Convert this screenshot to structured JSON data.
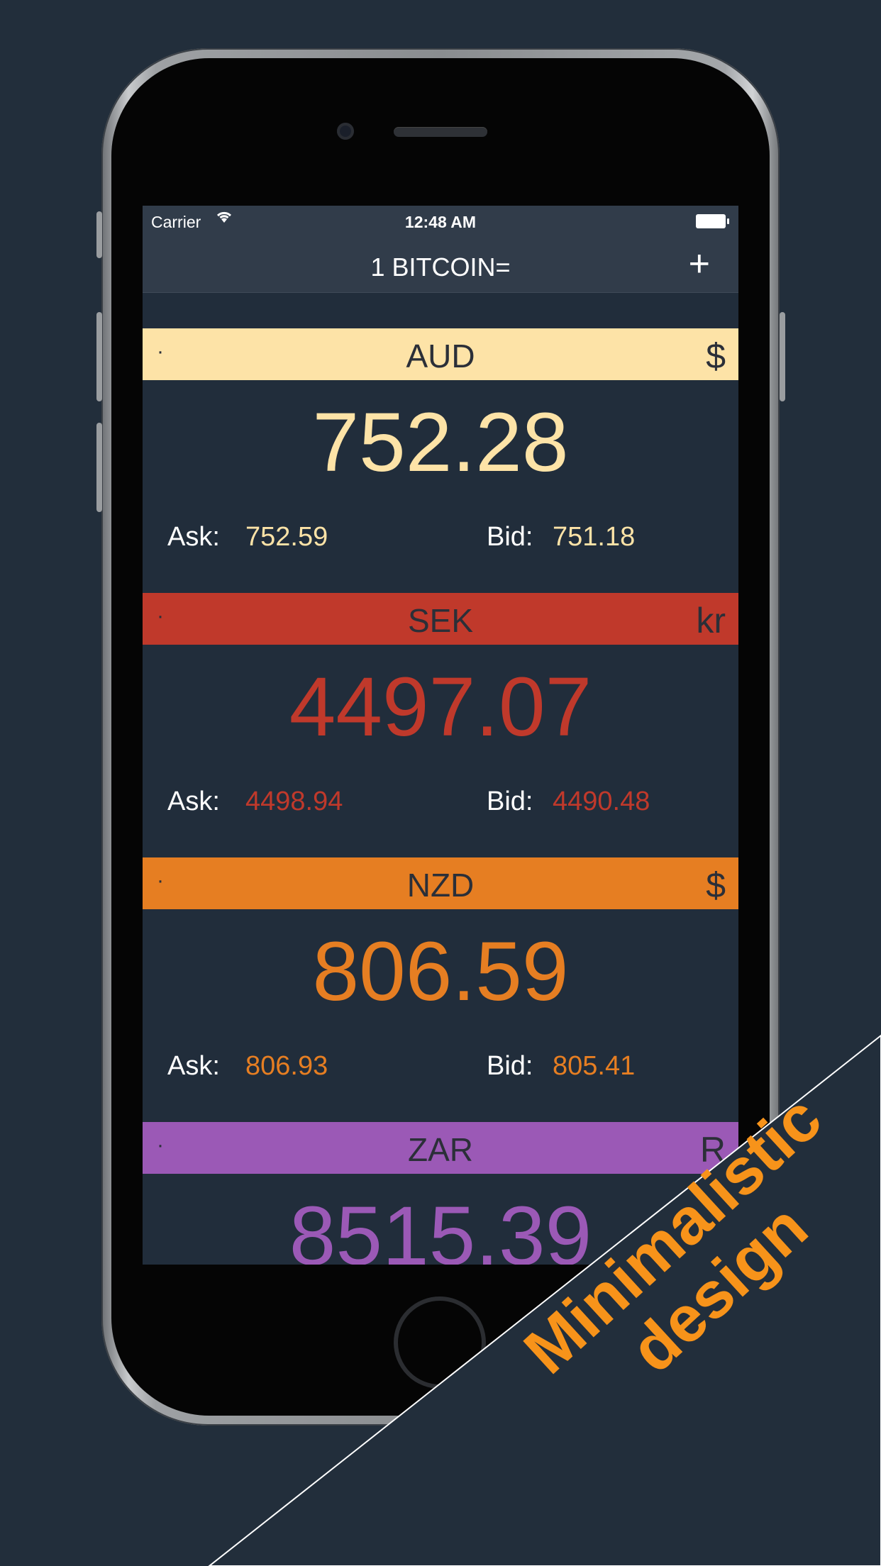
{
  "colors": {
    "background": "#222e3b",
    "screen_bg": "#212d3b",
    "banner_text": "#f7931a"
  },
  "status_bar": {
    "carrier": "Carrier",
    "wifi_icon": "wifi-icon",
    "time": "12:48 AM",
    "battery_icon": "battery-icon"
  },
  "nav": {
    "title": "1 BITCOIN=",
    "add_label": "+"
  },
  "currencies": [
    {
      "code": "AUD",
      "symbol": "$",
      "dot": "·",
      "price": "752.28",
      "ask_label": "Ask:",
      "ask": "752.59",
      "bid_label": "Bid:",
      "bid": "751.18",
      "bar_color": "#fde3a7",
      "value_color": "#fde3a7"
    },
    {
      "code": "SEK",
      "symbol": "kr",
      "dot": "·",
      "price": "4497.07",
      "ask_label": "Ask:",
      "ask": "4498.94",
      "bid_label": "Bid:",
      "bid": "4490.48",
      "bar_color": "#c0392b",
      "value_color": "#c0392b"
    },
    {
      "code": "NZD",
      "symbol": "$",
      "dot": "·",
      "price": "806.59",
      "ask_label": "Ask:",
      "ask": "806.93",
      "bid_label": "Bid:",
      "bid": "805.41",
      "bar_color": "#e67e22",
      "value_color": "#e67e22"
    },
    {
      "code": "ZAR",
      "symbol": "R",
      "dot": "·",
      "price": "8515.39",
      "ask_label": "",
      "ask": "",
      "bid_label": "",
      "bid": "",
      "bar_color": "#9b59b6",
      "value_color": "#9b59b6"
    }
  ],
  "banner": {
    "line1": "Minimalistic",
    "line2": "design"
  }
}
